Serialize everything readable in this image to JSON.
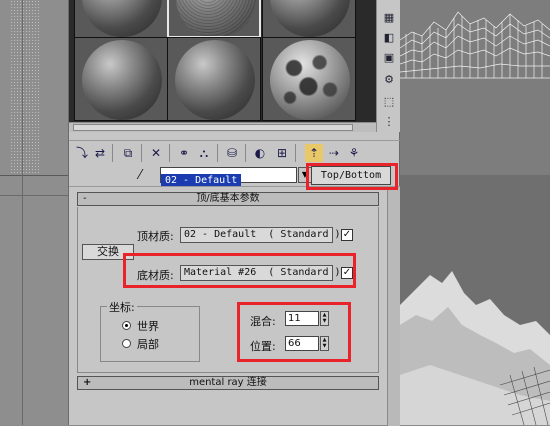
{
  "material_name": "02 - Default",
  "material_type_button": "Top/Bottom",
  "rollout_title": "顶/底基本参数",
  "rollout_collapse_sign": "-",
  "top_material": {
    "label": "顶材质:",
    "value": "02 - Default  ( Standard )",
    "enabled": "✓"
  },
  "bottom_material": {
    "label": "底材质:",
    "value": "Material #26  ( Standard )",
    "enabled": "✓"
  },
  "swap_button": "交换",
  "coordinates": {
    "title": "坐标:",
    "options": [
      "世界",
      "局部"
    ],
    "selected": "世界"
  },
  "blend": {
    "label": "混合:",
    "value": "11"
  },
  "position": {
    "label": "位置:",
    "value": "66"
  },
  "mental_ray_rollout": {
    "sign": "+",
    "title": "mental ray 连接"
  },
  "spinner_up": "▲",
  "spinner_down": "▼",
  "dropdown_arrow": "▼",
  "picker_glyph": "⁄",
  "highlight_color": "#e8232a"
}
